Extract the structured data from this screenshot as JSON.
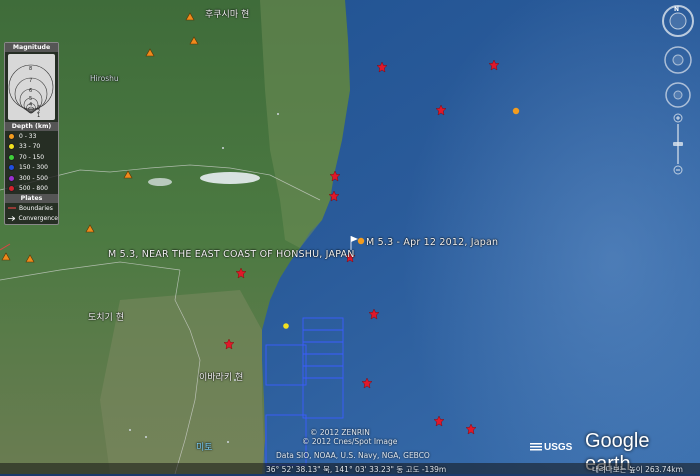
{
  "map": {
    "place_labels": {
      "fukushima": "후쿠시마 현",
      "hiroshu": "Hiroshu",
      "tochigi": "도치기 현",
      "ibaraki": "이바라키 현",
      "mito": "미토"
    },
    "event_labels": {
      "primary": "M 5.3 - Apr 12 2012, Japan",
      "secondary": "M 5.3, NEAR THE EAST COAST OF HONSHU, JAPAN"
    },
    "credits": {
      "line1": "© 2012 ZENRIN",
      "line2": "© 2012 Cnes/Spot Image",
      "line3": "Data SIO, NOAA, U.S. Navy, NGA, GEBCO"
    },
    "status_bar": {
      "coords": "36° 52' 38.13\" 북,  141° 03' 33.23\" 동  고도 -139m",
      "eye_alt": "내려다보는 높이  263.74km"
    },
    "branding": {
      "usgs": "USGS",
      "google_earth": "Google earth"
    }
  },
  "legend": {
    "magnitude_title": "Magnitude",
    "magnitude_values": [
      "8",
      "7",
      "6",
      "5",
      "4",
      "3",
      "2",
      "1"
    ],
    "depth_title": "Depth (km)",
    "depth_classes": [
      {
        "label": "0 - 33",
        "color": "#f39c1e"
      },
      {
        "label": "33 - 70",
        "color": "#f2e11f"
      },
      {
        "label": "70 - 150",
        "color": "#3fcf3a"
      },
      {
        "label": "150 - 300",
        "color": "#1f4fe0"
      },
      {
        "label": "300 - 500",
        "color": "#9a2fd1"
      },
      {
        "label": "500 - 800",
        "color": "#d6232d"
      }
    ],
    "plates_title": "Plates",
    "plates": {
      "boundaries": "Boundaries",
      "convergence": "Convergence"
    }
  },
  "colors": {
    "star": "#e0182a",
    "quake_shallow": "#f39c1e",
    "quake_intermediate": "#f2e11f",
    "ocean": "#1f4a8a",
    "land": "#3f6a3c"
  },
  "navigation": {
    "compass_letter": "N"
  }
}
